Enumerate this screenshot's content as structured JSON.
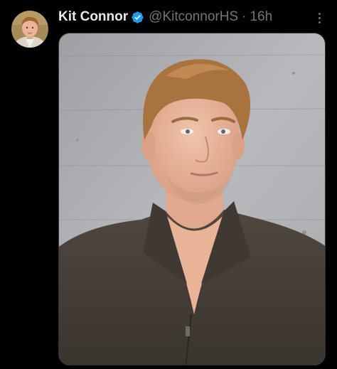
{
  "tweet": {
    "author": {
      "display_name": "Kit Connor",
      "verified": true,
      "handle": "@KitconnorHS"
    },
    "separator": "·",
    "timestamp": "16h"
  },
  "icons": {
    "verified": "verified-badge-icon",
    "more": "more-options-icon"
  },
  "colors": {
    "background": "#000000",
    "primary_text": "#e7e9ea",
    "secondary_text": "#71767b",
    "verified_blue": "#1d9bf0"
  }
}
